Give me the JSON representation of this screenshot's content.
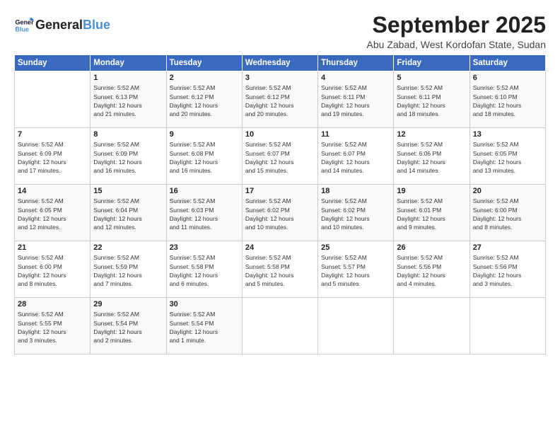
{
  "header": {
    "logo_line1": "General",
    "logo_line2": "Blue",
    "month": "September 2025",
    "location": "Abu Zabad, West Kordofan State, Sudan"
  },
  "days_of_week": [
    "Sunday",
    "Monday",
    "Tuesday",
    "Wednesday",
    "Thursday",
    "Friday",
    "Saturday"
  ],
  "weeks": [
    [
      {
        "day": "",
        "lines": []
      },
      {
        "day": "1",
        "lines": [
          "Sunrise: 5:52 AM",
          "Sunset: 6:13 PM",
          "Daylight: 12 hours",
          "and 21 minutes."
        ]
      },
      {
        "day": "2",
        "lines": [
          "Sunrise: 5:52 AM",
          "Sunset: 6:12 PM",
          "Daylight: 12 hours",
          "and 20 minutes."
        ]
      },
      {
        "day": "3",
        "lines": [
          "Sunrise: 5:52 AM",
          "Sunset: 6:12 PM",
          "Daylight: 12 hours",
          "and 20 minutes."
        ]
      },
      {
        "day": "4",
        "lines": [
          "Sunrise: 5:52 AM",
          "Sunset: 6:11 PM",
          "Daylight: 12 hours",
          "and 19 minutes."
        ]
      },
      {
        "day": "5",
        "lines": [
          "Sunrise: 5:52 AM",
          "Sunset: 6:11 PM",
          "Daylight: 12 hours",
          "and 18 minutes."
        ]
      },
      {
        "day": "6",
        "lines": [
          "Sunrise: 5:52 AM",
          "Sunset: 6:10 PM",
          "Daylight: 12 hours",
          "and 18 minutes."
        ]
      }
    ],
    [
      {
        "day": "7",
        "lines": [
          "Sunrise: 5:52 AM",
          "Sunset: 6:09 PM",
          "Daylight: 12 hours",
          "and 17 minutes."
        ]
      },
      {
        "day": "8",
        "lines": [
          "Sunrise: 5:52 AM",
          "Sunset: 6:09 PM",
          "Daylight: 12 hours",
          "and 16 minutes."
        ]
      },
      {
        "day": "9",
        "lines": [
          "Sunrise: 5:52 AM",
          "Sunset: 6:08 PM",
          "Daylight: 12 hours",
          "and 16 minutes."
        ]
      },
      {
        "day": "10",
        "lines": [
          "Sunrise: 5:52 AM",
          "Sunset: 6:07 PM",
          "Daylight: 12 hours",
          "and 15 minutes."
        ]
      },
      {
        "day": "11",
        "lines": [
          "Sunrise: 5:52 AM",
          "Sunset: 6:07 PM",
          "Daylight: 12 hours",
          "and 14 minutes."
        ]
      },
      {
        "day": "12",
        "lines": [
          "Sunrise: 5:52 AM",
          "Sunset: 6:06 PM",
          "Daylight: 12 hours",
          "and 14 minutes."
        ]
      },
      {
        "day": "13",
        "lines": [
          "Sunrise: 5:52 AM",
          "Sunset: 6:05 PM",
          "Daylight: 12 hours",
          "and 13 minutes."
        ]
      }
    ],
    [
      {
        "day": "14",
        "lines": [
          "Sunrise: 5:52 AM",
          "Sunset: 6:05 PM",
          "Daylight: 12 hours",
          "and 12 minutes."
        ]
      },
      {
        "day": "15",
        "lines": [
          "Sunrise: 5:52 AM",
          "Sunset: 6:04 PM",
          "Daylight: 12 hours",
          "and 12 minutes."
        ]
      },
      {
        "day": "16",
        "lines": [
          "Sunrise: 5:52 AM",
          "Sunset: 6:03 PM",
          "Daylight: 12 hours",
          "and 11 minutes."
        ]
      },
      {
        "day": "17",
        "lines": [
          "Sunrise: 5:52 AM",
          "Sunset: 6:02 PM",
          "Daylight: 12 hours",
          "and 10 minutes."
        ]
      },
      {
        "day": "18",
        "lines": [
          "Sunrise: 5:52 AM",
          "Sunset: 6:02 PM",
          "Daylight: 12 hours",
          "and 10 minutes."
        ]
      },
      {
        "day": "19",
        "lines": [
          "Sunrise: 5:52 AM",
          "Sunset: 6:01 PM",
          "Daylight: 12 hours",
          "and 9 minutes."
        ]
      },
      {
        "day": "20",
        "lines": [
          "Sunrise: 5:52 AM",
          "Sunset: 6:00 PM",
          "Daylight: 12 hours",
          "and 8 minutes."
        ]
      }
    ],
    [
      {
        "day": "21",
        "lines": [
          "Sunrise: 5:52 AM",
          "Sunset: 6:00 PM",
          "Daylight: 12 hours",
          "and 8 minutes."
        ]
      },
      {
        "day": "22",
        "lines": [
          "Sunrise: 5:52 AM",
          "Sunset: 5:59 PM",
          "Daylight: 12 hours",
          "and 7 minutes."
        ]
      },
      {
        "day": "23",
        "lines": [
          "Sunrise: 5:52 AM",
          "Sunset: 5:58 PM",
          "Daylight: 12 hours",
          "and 6 minutes."
        ]
      },
      {
        "day": "24",
        "lines": [
          "Sunrise: 5:52 AM",
          "Sunset: 5:58 PM",
          "Daylight: 12 hours",
          "and 5 minutes."
        ]
      },
      {
        "day": "25",
        "lines": [
          "Sunrise: 5:52 AM",
          "Sunset: 5:57 PM",
          "Daylight: 12 hours",
          "and 5 minutes."
        ]
      },
      {
        "day": "26",
        "lines": [
          "Sunrise: 5:52 AM",
          "Sunset: 5:56 PM",
          "Daylight: 12 hours",
          "and 4 minutes."
        ]
      },
      {
        "day": "27",
        "lines": [
          "Sunrise: 5:52 AM",
          "Sunset: 5:56 PM",
          "Daylight: 12 hours",
          "and 3 minutes."
        ]
      }
    ],
    [
      {
        "day": "28",
        "lines": [
          "Sunrise: 5:52 AM",
          "Sunset: 5:55 PM",
          "Daylight: 12 hours",
          "and 3 minutes."
        ]
      },
      {
        "day": "29",
        "lines": [
          "Sunrise: 5:52 AM",
          "Sunset: 5:54 PM",
          "Daylight: 12 hours",
          "and 2 minutes."
        ]
      },
      {
        "day": "30",
        "lines": [
          "Sunrise: 5:52 AM",
          "Sunset: 5:54 PM",
          "Daylight: 12 hours",
          "and 1 minute."
        ]
      },
      {
        "day": "",
        "lines": []
      },
      {
        "day": "",
        "lines": []
      },
      {
        "day": "",
        "lines": []
      },
      {
        "day": "",
        "lines": []
      }
    ]
  ]
}
